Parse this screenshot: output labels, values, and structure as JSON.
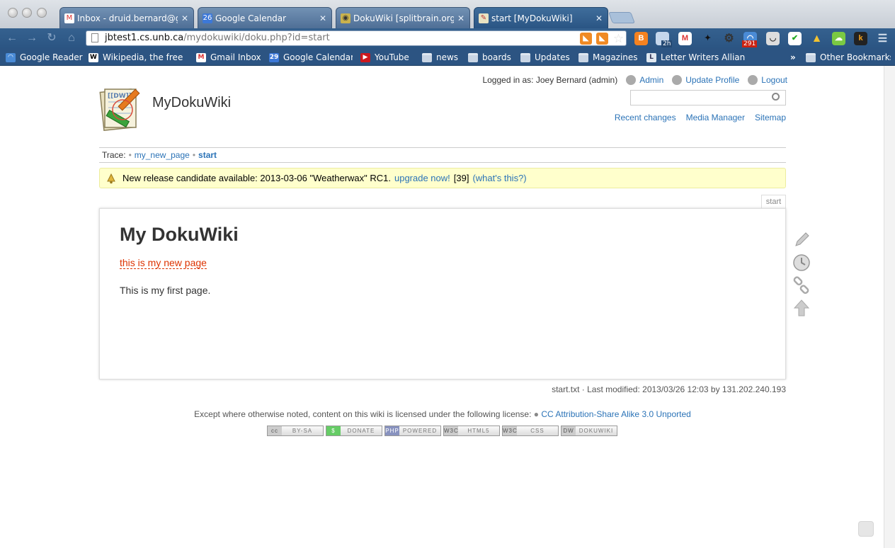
{
  "browser": {
    "tabs": [
      {
        "title": "Inbox - druid.bernard@gm",
        "icon": "gmail-icon"
      },
      {
        "title": "Google Calendar",
        "icon": "calendar-icon",
        "icon_text": "26"
      },
      {
        "title": "DokuWiki [splitbrain.org]",
        "icon": "dokuwiki-icon"
      },
      {
        "title": "start [MyDokuWiki]",
        "icon": "dokuwiki-icon"
      }
    ],
    "address_host": "jbtest1.cs.unb.ca",
    "address_path": "/mydokuwiki/doku.php?id=start",
    "ext_calendar_badge": "2h",
    "ext_reader_badge": "291",
    "bookmarks": [
      {
        "label": "Google Reader",
        "icon": "google-reader-icon"
      },
      {
        "label": "Wikipedia, the free e",
        "icon": "wikipedia-icon"
      },
      {
        "label": "Gmail Inbox",
        "icon": "gmail-icon"
      },
      {
        "label": "Google Calendar",
        "icon": "calendar-icon",
        "icon_text": "29"
      },
      {
        "label": "YouTube",
        "icon": "youtube-icon"
      },
      {
        "label": "news",
        "icon": "folder-icon"
      },
      {
        "label": "boards",
        "icon": "folder-icon"
      },
      {
        "label": "Updates",
        "icon": "folder-icon"
      },
      {
        "label": "Magazines",
        "icon": "folder-icon"
      },
      {
        "label": "Letter Writers Allianc",
        "icon": "lwa-icon"
      }
    ],
    "overflow_chevron": "»",
    "other_bookmarks": "Other Bookmarks"
  },
  "wiki": {
    "logged_in": "Logged in as: Joey Bernard (admin)",
    "admin": "Admin",
    "update_profile": "Update Profile",
    "logout": "Logout",
    "search_value": "",
    "recent_changes": "Recent changes",
    "media_manager": "Media Manager",
    "sitemap": "Sitemap",
    "site_title": "MyDokuWiki",
    "trace_label": "Trace:",
    "trace": [
      "my_new_page",
      "start"
    ],
    "msg_text": "New release candidate available: 2013-03-06 \"Weatherwax\" RC1.",
    "msg_upgrade": "upgrade now!",
    "msg_count": "[39]",
    "msg_whats": "(what's this?)",
    "page_id": "start",
    "heading": "My DokuWiki",
    "wikilink": "this is my new page",
    "paragraph": "This is my first page.",
    "docinfo": "start.txt · Last modified: 2013/03/26 12:03 by 131.202.240.193",
    "license_text": "Except where otherwise noted, content on this wiki is licensed under the following license:",
    "license_link": "CC Attribution-Share Alike 3.0 Unported",
    "badges": [
      {
        "left": "cc",
        "right": "BY-SA"
      },
      {
        "left": "$",
        "right": "DONATE"
      },
      {
        "left": "PHP",
        "right": "POWERED"
      },
      {
        "left": "W3C",
        "right": "HTML5"
      },
      {
        "left": "W3C",
        "right": "CSS"
      },
      {
        "left": "DW",
        "right": "DOKUWIKI"
      }
    ]
  },
  "colors": {
    "link": "#2b73b7",
    "wikilink_missing": "#dd3300",
    "msg_bg": "#ffffcc",
    "toolbar": "#2c5482"
  }
}
